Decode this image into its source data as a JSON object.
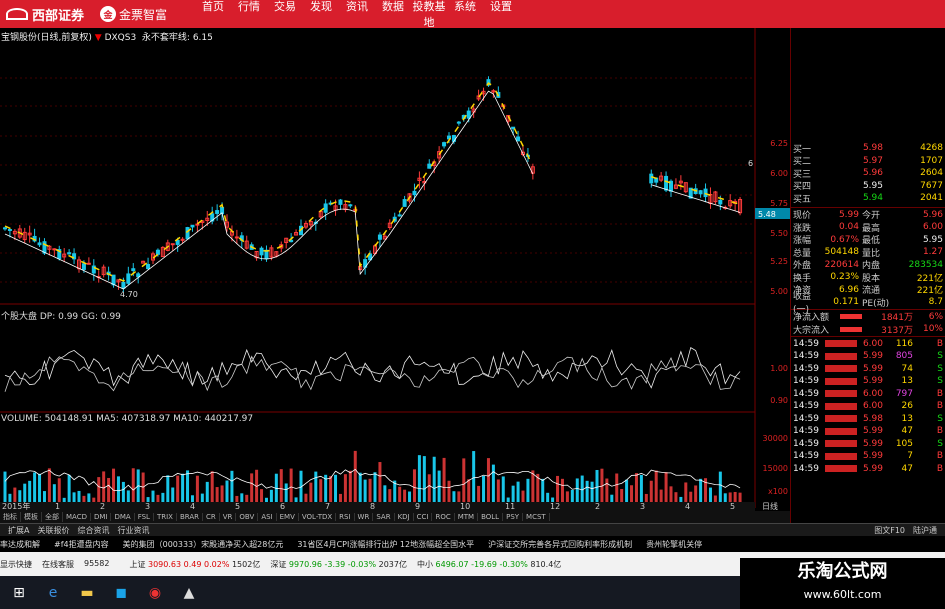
{
  "app": {
    "brand": "西部证券",
    "brand2": "金票智富",
    "brand2_mark": "金"
  },
  "menu": [
    "首页",
    "行情",
    "交易",
    "发现",
    "资讯",
    "数据",
    "投教基地",
    "系统",
    "设置"
  ],
  "chart": {
    "main_title": "宝钢股份(日线,前复权)",
    "main_indicator": "DXQS3",
    "main_line": "永不套牢线: 6.15",
    "price_ticks": [
      "6.25",
      "6.00",
      "5.75",
      "5.50",
      "5.25",
      "5.00"
    ],
    "current_price_tag": "5.48",
    "low_label": "4.70",
    "high_label_right": "6",
    "osc_title": "个股大盘 DP: 0.99 GG: 0.99",
    "osc_ticks": [
      "1.00",
      "0.90"
    ],
    "vol_title": "VOLUME: 504148.91  MA5: 407318.97  MA10: 440217.97",
    "vol_ticks": [
      "30000",
      "15000"
    ],
    "vol_unit": "x100",
    "year_label": "2015年",
    "months": [
      "1",
      "2",
      "3",
      "4",
      "5",
      "6",
      "7",
      "8",
      "9",
      "10",
      "11",
      "12",
      "2",
      "3",
      "4",
      "5"
    ],
    "period": "日线"
  },
  "tabs": [
    "指标",
    "模板",
    "全部",
    "MACD",
    "DMI",
    "DMA",
    "FSL",
    "TRIX",
    "BRAR",
    "CR",
    "VR",
    "OBV",
    "ASI",
    "EMV",
    "VOL-TDX",
    "RSI",
    "WR",
    "SAR",
    "KDJ",
    "CCI",
    "ROC",
    "MTM",
    "BOLL",
    "PSY",
    "MCST"
  ],
  "subtabs": [
    "扩展A",
    "关联报价",
    "综合资讯",
    "行业资讯"
  ],
  "subtabs_right": [
    "图文F10",
    "陆沪通"
  ],
  "orderbook": [
    {
      "label": "买一",
      "price": "5.98",
      "vol": "4268",
      "pc": "red"
    },
    {
      "label": "买二",
      "price": "5.97",
      "vol": "1707",
      "pc": "red"
    },
    {
      "label": "买三",
      "price": "5.96",
      "vol": "2604",
      "pc": "red"
    },
    {
      "label": "买四",
      "price": "5.95",
      "vol": "7677",
      "pc": "wht"
    },
    {
      "label": "买五",
      "price": "5.94",
      "vol": "2041",
      "pc": "grn"
    }
  ],
  "quote": [
    {
      "l1": "现价",
      "v1": "5.99",
      "c1": "red",
      "l2": "今开",
      "v2": "5.96",
      "c2": "red"
    },
    {
      "l1": "涨跌",
      "v1": "0.04",
      "c1": "red",
      "l2": "最高",
      "v2": "6.00",
      "c2": "red"
    },
    {
      "l1": "涨幅",
      "v1": "0.67%",
      "c1": "red",
      "l2": "最低",
      "v2": "5.95",
      "c2": "wht"
    },
    {
      "l1": "总量",
      "v1": "504148",
      "c1": "yel",
      "l2": "量比",
      "v2": "1.27",
      "c2": "red"
    },
    {
      "l1": "外盘",
      "v1": "220614",
      "c1": "red",
      "l2": "内盘",
      "v2": "283534",
      "c2": "grn"
    },
    {
      "l1": "换手",
      "v1": "0.23%",
      "c1": "yel",
      "l2": "股本",
      "v2": "221亿",
      "c2": "yel"
    },
    {
      "l1": "净资",
      "v1": "6.96",
      "c1": "yel",
      "l2": "流通",
      "v2": "221亿",
      "c2": "yel"
    },
    {
      "l1": "收益(一)",
      "v1": "0.171",
      "c1": "yel",
      "l2": "PE(动)",
      "v2": "8.7",
      "c2": "yel"
    }
  ],
  "flows": [
    {
      "label": "净流入额",
      "value": "1841万",
      "pct": "6%"
    },
    {
      "label": "大宗流入",
      "value": "3137万",
      "pct": "10%"
    }
  ],
  "ticks": [
    {
      "t": "14:59",
      "p": "6.00",
      "v": "116",
      "s": "B",
      "vc": "yel"
    },
    {
      "t": "14:59",
      "p": "5.99",
      "v": "805",
      "s": "S",
      "vc": "mag"
    },
    {
      "t": "14:59",
      "p": "5.99",
      "v": "74",
      "s": "S",
      "vc": "yel"
    },
    {
      "t": "14:59",
      "p": "5.99",
      "v": "13",
      "s": "S",
      "vc": "yel"
    },
    {
      "t": "14:59",
      "p": "6.00",
      "v": "797",
      "s": "B",
      "vc": "mag"
    },
    {
      "t": "14:59",
      "p": "6.00",
      "v": "26",
      "s": "B",
      "vc": "yel"
    },
    {
      "t": "14:59",
      "p": "5.98",
      "v": "13",
      "s": "S",
      "vc": "yel"
    },
    {
      "t": "14:59",
      "p": "5.99",
      "v": "47",
      "s": "B",
      "vc": "yel"
    },
    {
      "t": "14:59",
      "p": "5.99",
      "v": "105",
      "s": "S",
      "vc": "yel"
    },
    {
      "t": "14:59",
      "p": "5.99",
      "v": "7",
      "s": "B",
      "vc": "yel"
    },
    {
      "t": "14:59",
      "p": "5.99",
      "v": "47",
      "s": "B",
      "vc": "yel"
    }
  ],
  "news": [
    "率达成和解",
    "#f4拒遭盘内容",
    "美的集团（000333）宋殿通净买入超28亿元",
    "31省区4月CPI涨幅排行出炉 12地涨幅超全国水平",
    "沪深证交所完善各异式回购利率形成机制",
    "贵州轮擎机关停"
  ],
  "status": {
    "items": [
      "显示快捷",
      "在线客服",
      "95582"
    ],
    "sh_label": "上证",
    "sh_value": "3090.63",
    "sh_chg": "0.49",
    "sh_pct": "0.02%",
    "sh_amt": "1502亿",
    "sz_label": "深证",
    "sz_value": "9970.96",
    "sz_chg": "-3.39",
    "sz_pct": "-0.03%",
    "sz_amt": "2037亿",
    "zx_label": "中小",
    "zx_value": "6496.07",
    "zx_chg": "-19.69",
    "zx_pct": "-0.30%",
    "zx_amt": "810.4亿"
  },
  "watermark": {
    "title": "乐淘公式网",
    "url": "www.60lt.com"
  },
  "colors": {
    "topbar": "#d81e2c",
    "up": "#ff3b3b",
    "down": "#16d916",
    "line_yellow": "#ffd700",
    "candle_cyan": "#19c6e8"
  }
}
